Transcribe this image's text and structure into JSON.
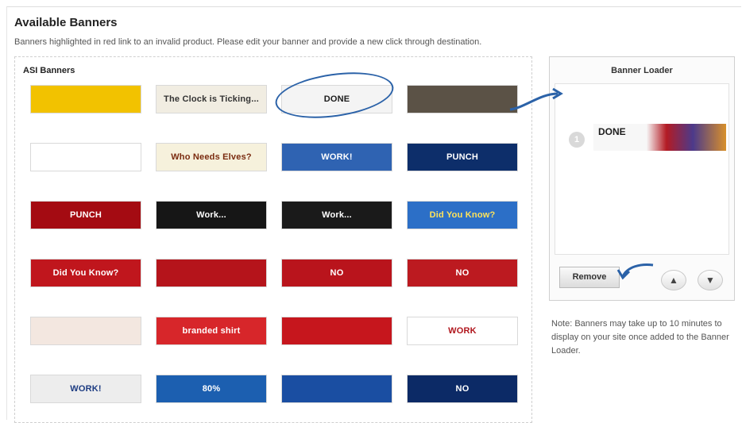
{
  "header": {
    "title": "Available Banners",
    "subtitle": "Banners highlighted in red link to an invalid product. Please edit your banner and provide a new click through destination."
  },
  "asi": {
    "label": "ASI Banners",
    "banners": [
      {
        "text": "",
        "bg": "#f2c200",
        "fg": "#b01e1e"
      },
      {
        "text": "The Clock is Ticking...",
        "bg": "#f1ede2",
        "fg": "#333333"
      },
      {
        "text": "DONE",
        "bg": "#f4f4f4",
        "fg": "#1b1b1b"
      },
      {
        "text": "",
        "bg": "#5b5246",
        "fg": "#f0e6c8"
      },
      {
        "text": "",
        "bg": "#ffffff",
        "fg": "#1b3b7a"
      },
      {
        "text": "Who Needs Elves?",
        "bg": "#f6f1dc",
        "fg": "#7a2b0f"
      },
      {
        "text": "WORK!",
        "bg": "#2f63b2",
        "fg": "#ffffff"
      },
      {
        "text": "PUNCH",
        "bg": "#0d2e6a",
        "fg": "#ffffff"
      },
      {
        "text": "PUNCH",
        "bg": "#a40b12",
        "fg": "#ffffff"
      },
      {
        "text": "Work...",
        "bg": "#161616",
        "fg": "#ffffff"
      },
      {
        "text": "Work...",
        "bg": "#1a1a1a",
        "fg": "#ffffff"
      },
      {
        "text": "Did You Know?",
        "bg": "#2c6fc7",
        "fg": "#ffe35a"
      },
      {
        "text": "Did You Know?",
        "bg": "#c0161d",
        "fg": "#ffffff"
      },
      {
        "text": "",
        "bg": "#b5141b",
        "fg": "#ffffff"
      },
      {
        "text": "NO",
        "bg": "#b9141c",
        "fg": "#ffffff"
      },
      {
        "text": "NO",
        "bg": "#bc1a20",
        "fg": "#ffffff"
      },
      {
        "text": "",
        "bg": "#f3e7e0",
        "fg": "#b0151c"
      },
      {
        "text": "branded shirt",
        "bg": "#d7262a",
        "fg": "#ffffff"
      },
      {
        "text": "",
        "bg": "#c6161d",
        "fg": "#ffffff"
      },
      {
        "text": "WORK",
        "bg": "#ffffff",
        "fg": "#b0151c"
      },
      {
        "text": "WORK!",
        "bg": "#ededed",
        "fg": "#1d3c82"
      },
      {
        "text": "80%",
        "bg": "#1c5fb0",
        "fg": "#ffffff"
      },
      {
        "text": "",
        "bg": "#1a4ea2",
        "fg": "#ffffff"
      },
      {
        "text": "NO",
        "bg": "#0c2a66",
        "fg": "#ffffff"
      }
    ]
  },
  "loader": {
    "title": "Banner Loader",
    "slot_number": "1",
    "slot_banner_text": "DONE",
    "remove_label": "Remove",
    "up_icon": "chevron-up-icon",
    "down_icon": "chevron-down-icon"
  },
  "note": "Note: Banners may take up to 10 minutes to display on your site once added to the Banner Loader.",
  "colors": {
    "annotation": "#2b62a8"
  }
}
